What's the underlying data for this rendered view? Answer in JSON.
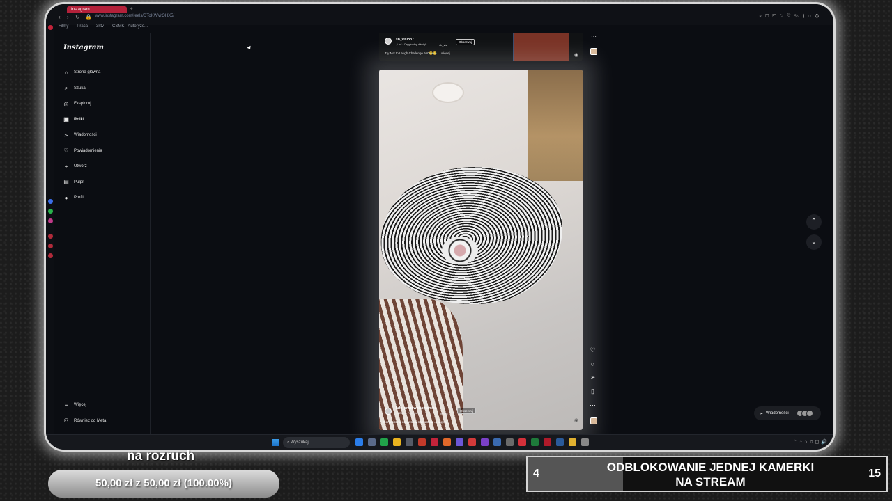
{
  "browser": {
    "tab_title": "Instagram",
    "url": "www.instagram.com/reels/DToKWVrOHX5/",
    "bookmarks": [
      "Filmy",
      "Praca",
      "3ktv",
      "CSMK - Autoryzo..."
    ]
  },
  "instagram": {
    "logo": "Instagram",
    "nav": [
      {
        "label": "Strona główna",
        "icon": "home-icon"
      },
      {
        "label": "Szukaj",
        "icon": "search-icon"
      },
      {
        "label": "Eksploruj",
        "icon": "compass-icon"
      },
      {
        "label": "Rolki",
        "icon": "reels-icon"
      },
      {
        "label": "Wiadomości",
        "icon": "send-icon"
      },
      {
        "label": "Powiadomienia",
        "icon": "heart-icon"
      },
      {
        "label": "Utwórz",
        "icon": "plus-icon"
      },
      {
        "label": "Pulpit",
        "icon": "dashboard-icon"
      },
      {
        "label": "Profil",
        "icon": "profile-icon"
      }
    ],
    "bottom_nav": [
      {
        "label": "Więcej",
        "icon": "menu-icon"
      },
      {
        "label": "Również od Meta",
        "icon": "meta-icon"
      }
    ],
    "reel_prev": {
      "username": "sb_vision7",
      "audio": "♬ sf · Oryginalny dźwięk",
      "tag": "sb_visi",
      "follow": "Obserwuj",
      "caption": "Try Not to Laugh Challenge 660😂😂 ... więcej"
    },
    "reel_current": {
      "username": "lufo_pracowniaceramiki",
      "audio": "♬ Damn Fine Coffee",
      "tag": "milled",
      "follow": "Obserwuj",
      "caption": "Ceramiczna umywalka nablatowa ... więcej"
    },
    "actions": [
      "like-icon",
      "comment-icon",
      "share-icon",
      "save-icon",
      "more-icon"
    ],
    "messages_pill": "Wiadomości"
  },
  "taskbar": {
    "search_placeholder": "Wyszukaj"
  },
  "overlay": {
    "goal_title": "na rozruch",
    "goal_progress_text": "50,00 zł  z  50,00 zł (100.00%)",
    "goal_progress_fraction": 1.0,
    "unlock_current": "4",
    "unlock_label_line1": "ODBLOKOWANIE JEDNEJ KAMERKI",
    "unlock_label_line2": "NA STREAM",
    "unlock_total": "15",
    "unlock_fraction": 0.2667
  },
  "colors": {
    "tab_accent": "#b3213a",
    "ig_background": "#0b0d12"
  }
}
